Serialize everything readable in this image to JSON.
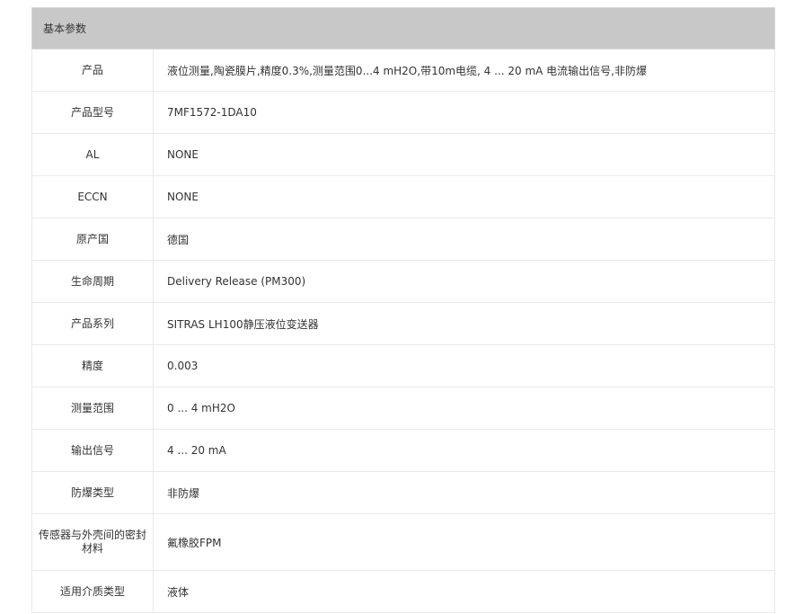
{
  "section_title": "基本参数",
  "rows": [
    {
      "label": "产品",
      "value": "液位测量,陶瓷膜片,精度0.3%,测量范围0...4 mH2O,带10m电缆, 4 ... 20 mA 电流输出信号,非防爆"
    },
    {
      "label": "产品型号",
      "value": "7MF1572-1DA10"
    },
    {
      "label": "AL",
      "value": "NONE"
    },
    {
      "label": "ECCN",
      "value": "NONE"
    },
    {
      "label": "原产国",
      "value": "德国"
    },
    {
      "label": "生命周期",
      "value": "Delivery Release (PM300)"
    },
    {
      "label": "产品系列",
      "value": "SITRAS LH100静压液位变送器"
    },
    {
      "label": "精度",
      "value": "0.003"
    },
    {
      "label": "测量范围",
      "value": "0 ... 4 mH2O"
    },
    {
      "label": "输出信号",
      "value": "4 ... 20 mA"
    },
    {
      "label": "防爆类型",
      "value": "非防爆"
    },
    {
      "label": "传感器与外壳间的密封材料",
      "value": "氟橡胶FPM"
    },
    {
      "label": "适用介质类型",
      "value": "液体"
    }
  ]
}
